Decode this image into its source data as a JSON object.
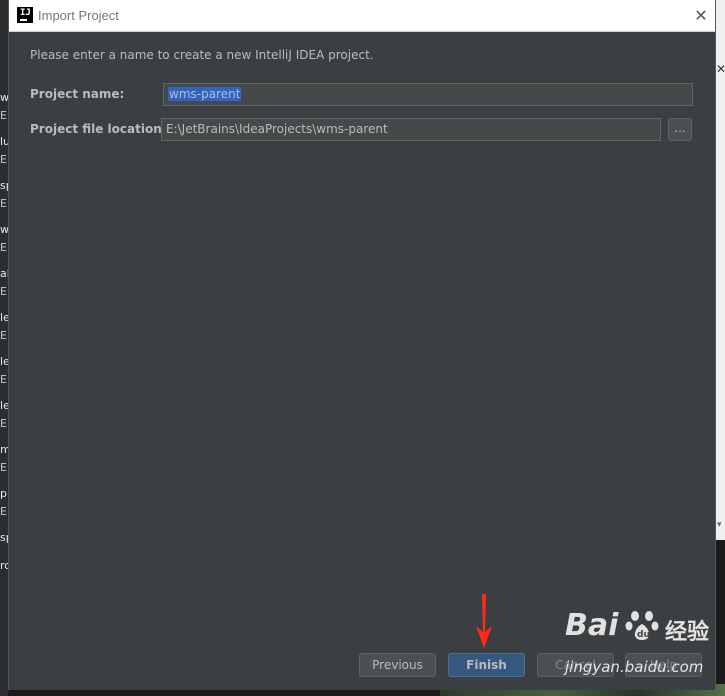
{
  "window": {
    "title": "Import Project",
    "close_glyph": "✕"
  },
  "form": {
    "intro": "Please enter a name to create a new IntelliJ IDEA project.",
    "project_name_label": "Project name:",
    "project_name_value": "wms-parent",
    "location_label": "Project file location:",
    "location_value": "E:\\JetBrains\\IdeaProjects\\wms-parent",
    "browse_label": "..."
  },
  "buttons": {
    "previous": "Previous",
    "finish": "Finish",
    "cancel": "Cancel",
    "help": "Help"
  },
  "background_fragments": [
    "w",
    "E:",
    "lu",
    "E:",
    "sp",
    "E:",
    "w",
    "E:",
    "al",
    "E:",
    "le",
    "E:",
    "le",
    "E:",
    "le",
    "E:",
    "m",
    "E:",
    "p",
    "E:",
    "sp",
    "ro"
  ],
  "watermark": {
    "brand": "Bai",
    "chinese": "经验",
    "url": "jingyan.baidu.com"
  },
  "colors": {
    "dialog_bg": "#3c3f41",
    "field_bg": "#45494a",
    "selection": "#2f65ca",
    "finish_button": "#365880",
    "arrow": "#ff2a1a"
  },
  "icons": {
    "app": "intellij-idea-icon",
    "close": "close-icon",
    "annotation": "red-arrow-down"
  }
}
